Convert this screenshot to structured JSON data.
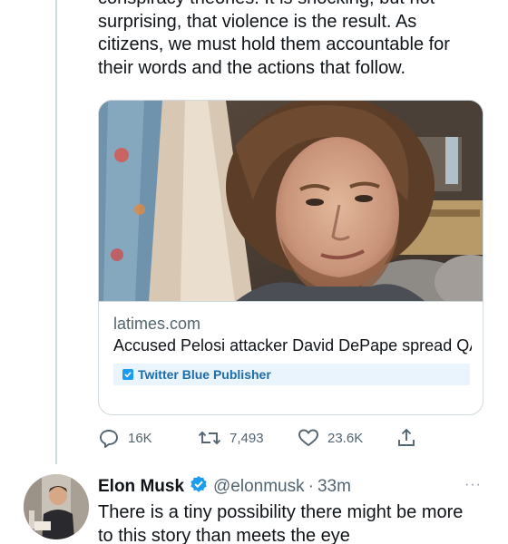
{
  "tweet1": {
    "body_lines": [
      "conspiracy theories. It is shocking, but not",
      "surprising, that violence is the result. As",
      "citizens, we must hold them accountable for",
      "their words and the actions that follow."
    ],
    "card": {
      "image_icon": "photo-of-man",
      "domain": "latimes.com",
      "title": "Accused Pelosi attacker David DePape spread QAnon, other far-right, bigoted c...",
      "badge": {
        "icon": "twitter-blue-check-icon",
        "label": "Twitter Blue Publisher"
      }
    },
    "actions": {
      "reply": {
        "icon": "reply-icon",
        "count": "16K"
      },
      "retweet": {
        "icon": "retweet-icon",
        "count": "7,493"
      },
      "like": {
        "icon": "heart-icon",
        "count": "23.6K"
      },
      "share": {
        "icon": "share-icon"
      }
    }
  },
  "tweet2": {
    "avatar_icon": "avatar",
    "name": "Elon Musk",
    "verified_icon": "verified-badge-icon",
    "handle": "@elonmusk",
    "separator": "·",
    "time": "33m",
    "more": "···",
    "text_lines": [
      "There is a tiny possibility there might be more",
      "to this story than meets the eye"
    ]
  },
  "colors": {
    "text_primary": "#0f1419",
    "text_secondary": "#536471",
    "border": "#cfd9de",
    "accent": "#1d9bf0",
    "badge_bg": "#eaf4fc"
  }
}
